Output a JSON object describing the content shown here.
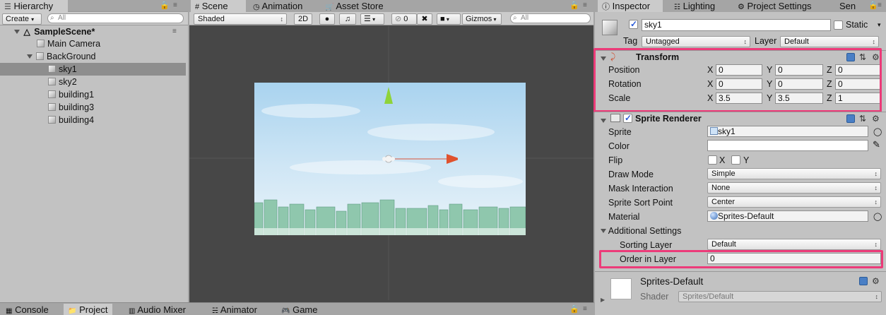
{
  "window": {
    "maximize_icon": "window-icon",
    "lock_icon": "lock-icon",
    "menu_icon": "menu-icon"
  },
  "hierarchy": {
    "tab_label": "Hierarchy",
    "create_label": "Create",
    "search_placeholder": "All",
    "scene_name": "SampleScene*",
    "items": [
      {
        "label": "Main Camera"
      },
      {
        "label": "BackGround"
      },
      {
        "label": "sky1"
      },
      {
        "label": "sky2"
      },
      {
        "label": "building1"
      },
      {
        "label": "building3"
      },
      {
        "label": "building4"
      }
    ]
  },
  "scene": {
    "tabs": [
      {
        "label": "Scene"
      },
      {
        "label": "Animation"
      },
      {
        "label": "Asset Store"
      }
    ],
    "shading_mode": "Shaded",
    "mode_2d": "2D",
    "hidden_count": "0",
    "gizmos_label": "Gizmos",
    "search_placeholder": "All"
  },
  "bottom_tabs": [
    {
      "label": "Console"
    },
    {
      "label": "Project"
    },
    {
      "label": "Audio Mixer"
    },
    {
      "label": "Animator"
    },
    {
      "label": "Game"
    }
  ],
  "inspector": {
    "tabs": [
      {
        "label": "Inspector"
      },
      {
        "label": "Lighting"
      },
      {
        "label": "Project Settings"
      },
      {
        "label": "Sen"
      }
    ],
    "object_name": "sky1",
    "static_label": "Static",
    "tag_label": "Tag",
    "tag_value": "Untagged",
    "layer_label": "Layer",
    "layer_value": "Default",
    "transform": {
      "title": "Transform",
      "position_label": "Position",
      "rotation_label": "Rotation",
      "scale_label": "Scale",
      "x": "X",
      "y": "Y",
      "z": "Z",
      "position": {
        "x": "0",
        "y": "0",
        "z": "0"
      },
      "rotation": {
        "x": "0",
        "y": "0",
        "z": "0"
      },
      "scale": {
        "x": "3.5",
        "y": "3.5",
        "z": "1"
      }
    },
    "sprite_renderer": {
      "title": "Sprite Renderer",
      "sprite_label": "Sprite",
      "sprite_value": "sky1",
      "color_label": "Color",
      "color_value": "#ffffff",
      "flip_label": "Flip",
      "flip_x": "X",
      "flip_y": "Y",
      "draw_mode_label": "Draw Mode",
      "draw_mode_value": "Simple",
      "mask_label": "Mask Interaction",
      "mask_value": "None",
      "sort_point_label": "Sprite Sort Point",
      "sort_point_value": "Center",
      "material_label": "Material",
      "material_value": "Sprites-Default",
      "additional_label": "Additional Settings",
      "sorting_layer_label": "Sorting Layer",
      "sorting_layer_value": "Default",
      "order_label": "Order in Layer",
      "order_value": "0"
    },
    "material": {
      "name": "Sprites-Default",
      "shader_label": "Shader",
      "shader_value": "Sprites/Default"
    }
  },
  "colors": {
    "highlight": "#ec3b79",
    "sky_top": "#a9d3ef",
    "scene_bg": "#474747"
  }
}
